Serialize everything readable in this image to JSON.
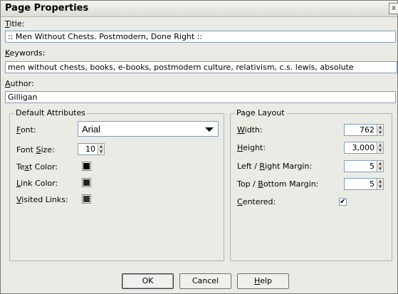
{
  "dialog": {
    "title": "Page Properties",
    "close_glyph": "x"
  },
  "fields": {
    "title_label_ul": "T",
    "title_label_rest": "itle:",
    "title_value": ":: Men Without Chests. Postmodern, Done Right ::",
    "keywords_label_ul": "K",
    "keywords_label_rest": "eywords:",
    "keywords_value": "men without chests, books, e-books, postmodern culture, relativism, c.s. lewis, absolute",
    "author_label_ul": "A",
    "author_label_rest": "uthor:",
    "author_value": "Gilligan"
  },
  "default_attributes": {
    "legend": "Default Attributes",
    "font_label_ul": "F",
    "font_label_rest": "ont:",
    "font_value": "Arial",
    "font_size_label_pre": "Font ",
    "font_size_label_ul": "S",
    "font_size_label_rest": "ize:",
    "font_size_value": "10",
    "text_color_label_pre": "Te",
    "text_color_label_ul": "x",
    "text_color_label_rest": "t Color:",
    "text_color": "#000000",
    "link_color_label_ul": "L",
    "link_color_label_rest": "ink Color:",
    "link_color": "#222222",
    "visited_label_ul": "V",
    "visited_label_rest": "isited Links:",
    "visited_color": "#333333"
  },
  "page_layout": {
    "legend": "Page Layout",
    "width_label_ul": "W",
    "width_label_rest": "idth:",
    "width_value": "762",
    "height_label_ul": "H",
    "height_label_rest": "eight:",
    "height_value": "3,000",
    "lr_label_pre": "Left / ",
    "lr_label_ul": "R",
    "lr_label_rest": "ight Margin:",
    "lr_value": "5",
    "tb_label_pre": "Top / ",
    "tb_label_ul": "B",
    "tb_label_rest": "ottom Margin:",
    "tb_value": "5",
    "centered_label_ul": "C",
    "centered_label_rest": "entered:",
    "centered_mark": "✔"
  },
  "buttons": {
    "ok": "OK",
    "cancel": "Cancel",
    "help_ul": "H",
    "help_rest": "elp"
  }
}
